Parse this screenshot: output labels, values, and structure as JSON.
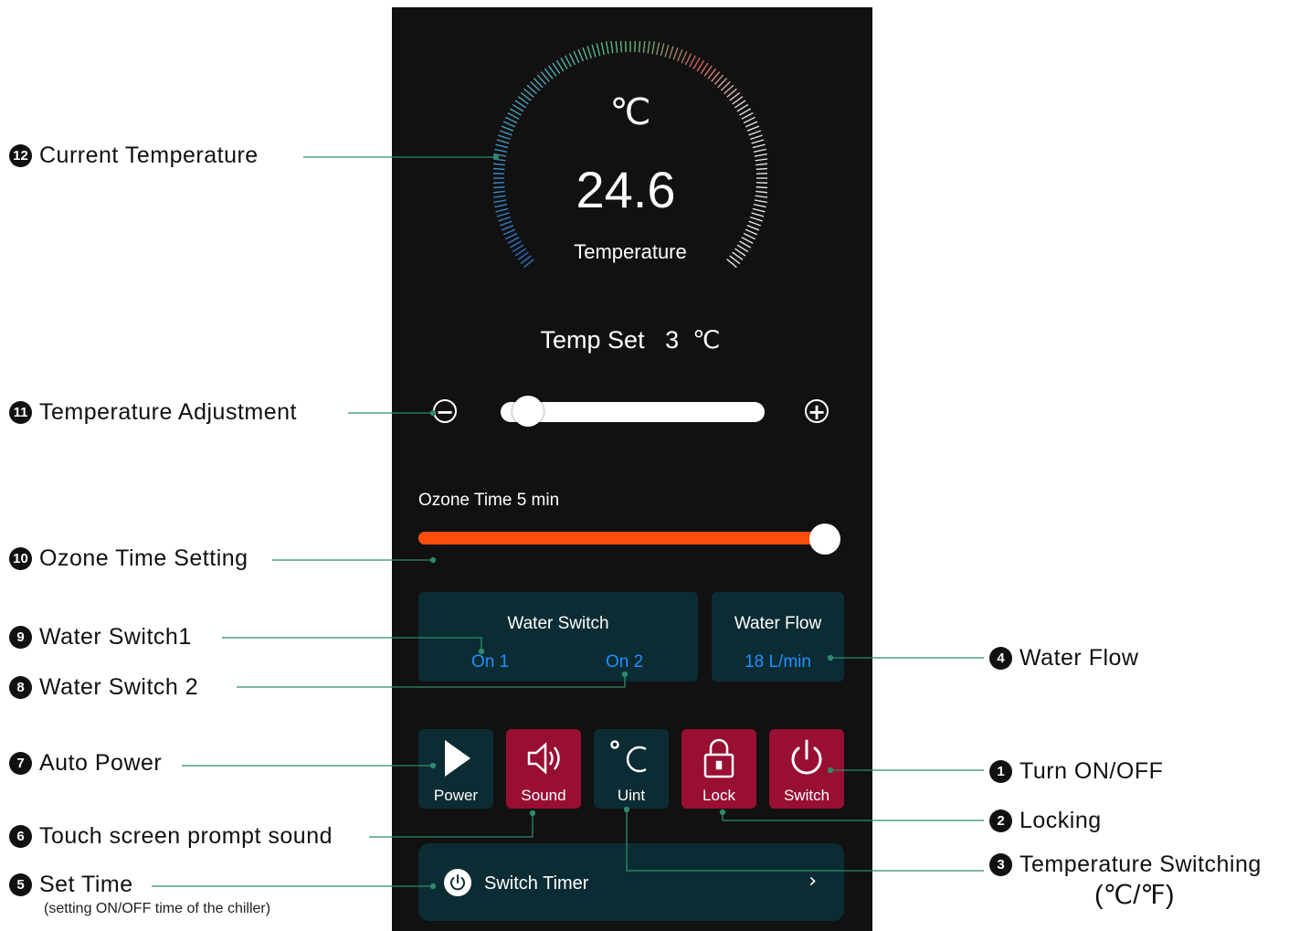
{
  "gauge": {
    "unit": "℃",
    "value": "24.6",
    "caption": "Temperature"
  },
  "temp_set": {
    "label": "Temp Set",
    "value": "3",
    "unit": "℃",
    "minus_icon": "minus-circle-icon",
    "plus_icon": "plus-circle-icon",
    "slider_level": 0.05
  },
  "ozone": {
    "label": "Ozone Time 5 min",
    "level": 1.0,
    "color": "#ff4d0a"
  },
  "water_switch": {
    "title": "Water Switch",
    "switch1": "On 1",
    "switch2": "On 2"
  },
  "water_flow": {
    "title": "Water Flow",
    "value": "18 L/min"
  },
  "tiles": [
    {
      "label": "Power",
      "icon": "play-icon",
      "style": "dark"
    },
    {
      "label": "Sound",
      "icon": "speaker-icon",
      "style": "red"
    },
    {
      "label": "Uint",
      "icon": "celsius-icon",
      "style": "dark"
    },
    {
      "label": "Lock",
      "icon": "lock-icon",
      "style": "red"
    },
    {
      "label": "Switch",
      "icon": "power-icon",
      "style": "red"
    }
  ],
  "timer": {
    "label": "Switch Timer",
    "icon": "power-icon",
    "chevron": "›"
  },
  "colors": {
    "phone_bg": "#111111",
    "card_bg": "#0c2c34",
    "tile_red": "#980f33",
    "accent_blue": "#1e90ff",
    "leader_line": "#2f8a6a"
  },
  "annotations": {
    "a12": {
      "num": "12",
      "text": "Current Temperature"
    },
    "a11": {
      "num": "11",
      "text": "Temperature Adjustment"
    },
    "a10": {
      "num": "10",
      "text": "Ozone Time Setting"
    },
    "a9": {
      "num": "9",
      "text": "Water Switch1"
    },
    "a8": {
      "num": "8",
      "text": "Water Switch 2"
    },
    "a7": {
      "num": "7",
      "text": "Auto Power"
    },
    "a6": {
      "num": "6",
      "text": "Touch screen prompt sound"
    },
    "a5": {
      "num": "5",
      "text": "Set Time",
      "note": "(setting ON/OFF time of the chiller)"
    },
    "a4": {
      "num": "4",
      "text": "Water Flow"
    },
    "a1": {
      "num": "1",
      "text": "Turn ON/OFF"
    },
    "a2": {
      "num": "2",
      "text": "Locking"
    },
    "a3": {
      "num": "3",
      "text": "Temperature Switching",
      "cont": "(℃/℉)"
    }
  }
}
